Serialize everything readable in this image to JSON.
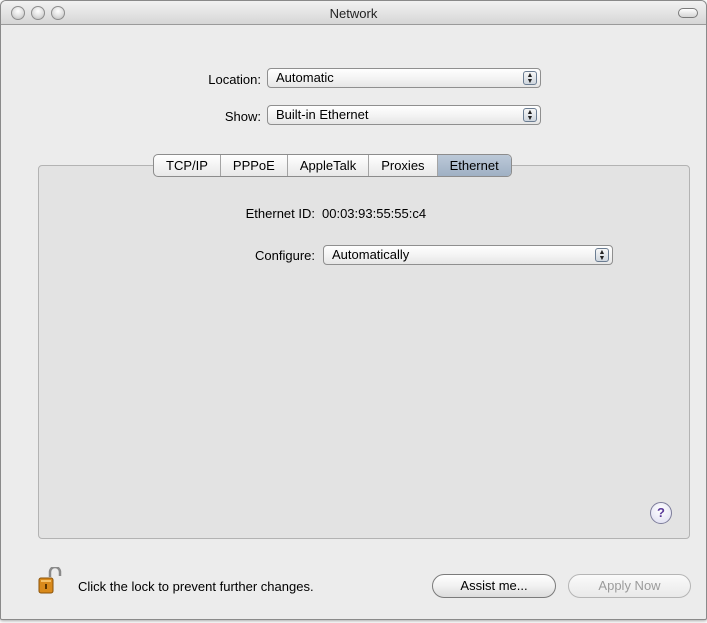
{
  "window": {
    "title": "Network"
  },
  "location": {
    "label": "Location:",
    "value": "Automatic"
  },
  "show": {
    "label": "Show:",
    "value": "Built-in Ethernet"
  },
  "tabs": [
    {
      "label": "TCP/IP"
    },
    {
      "label": "PPPoE"
    },
    {
      "label": "AppleTalk"
    },
    {
      "label": "Proxies"
    },
    {
      "label": "Ethernet",
      "selected": true
    }
  ],
  "ethernet": {
    "id_label": "Ethernet ID:",
    "id_value": "00:03:93:55:55:c4",
    "configure_label": "Configure:",
    "configure_value": "Automatically"
  },
  "help": {
    "glyph": "?"
  },
  "footer": {
    "lock_text": "Click the lock to prevent further changes.",
    "assist_label": "Assist me...",
    "apply_label": "Apply Now"
  },
  "icons": {
    "lock": "padlock-open-icon",
    "help": "help-icon",
    "popup_arrows": "updown-arrows-icon"
  }
}
